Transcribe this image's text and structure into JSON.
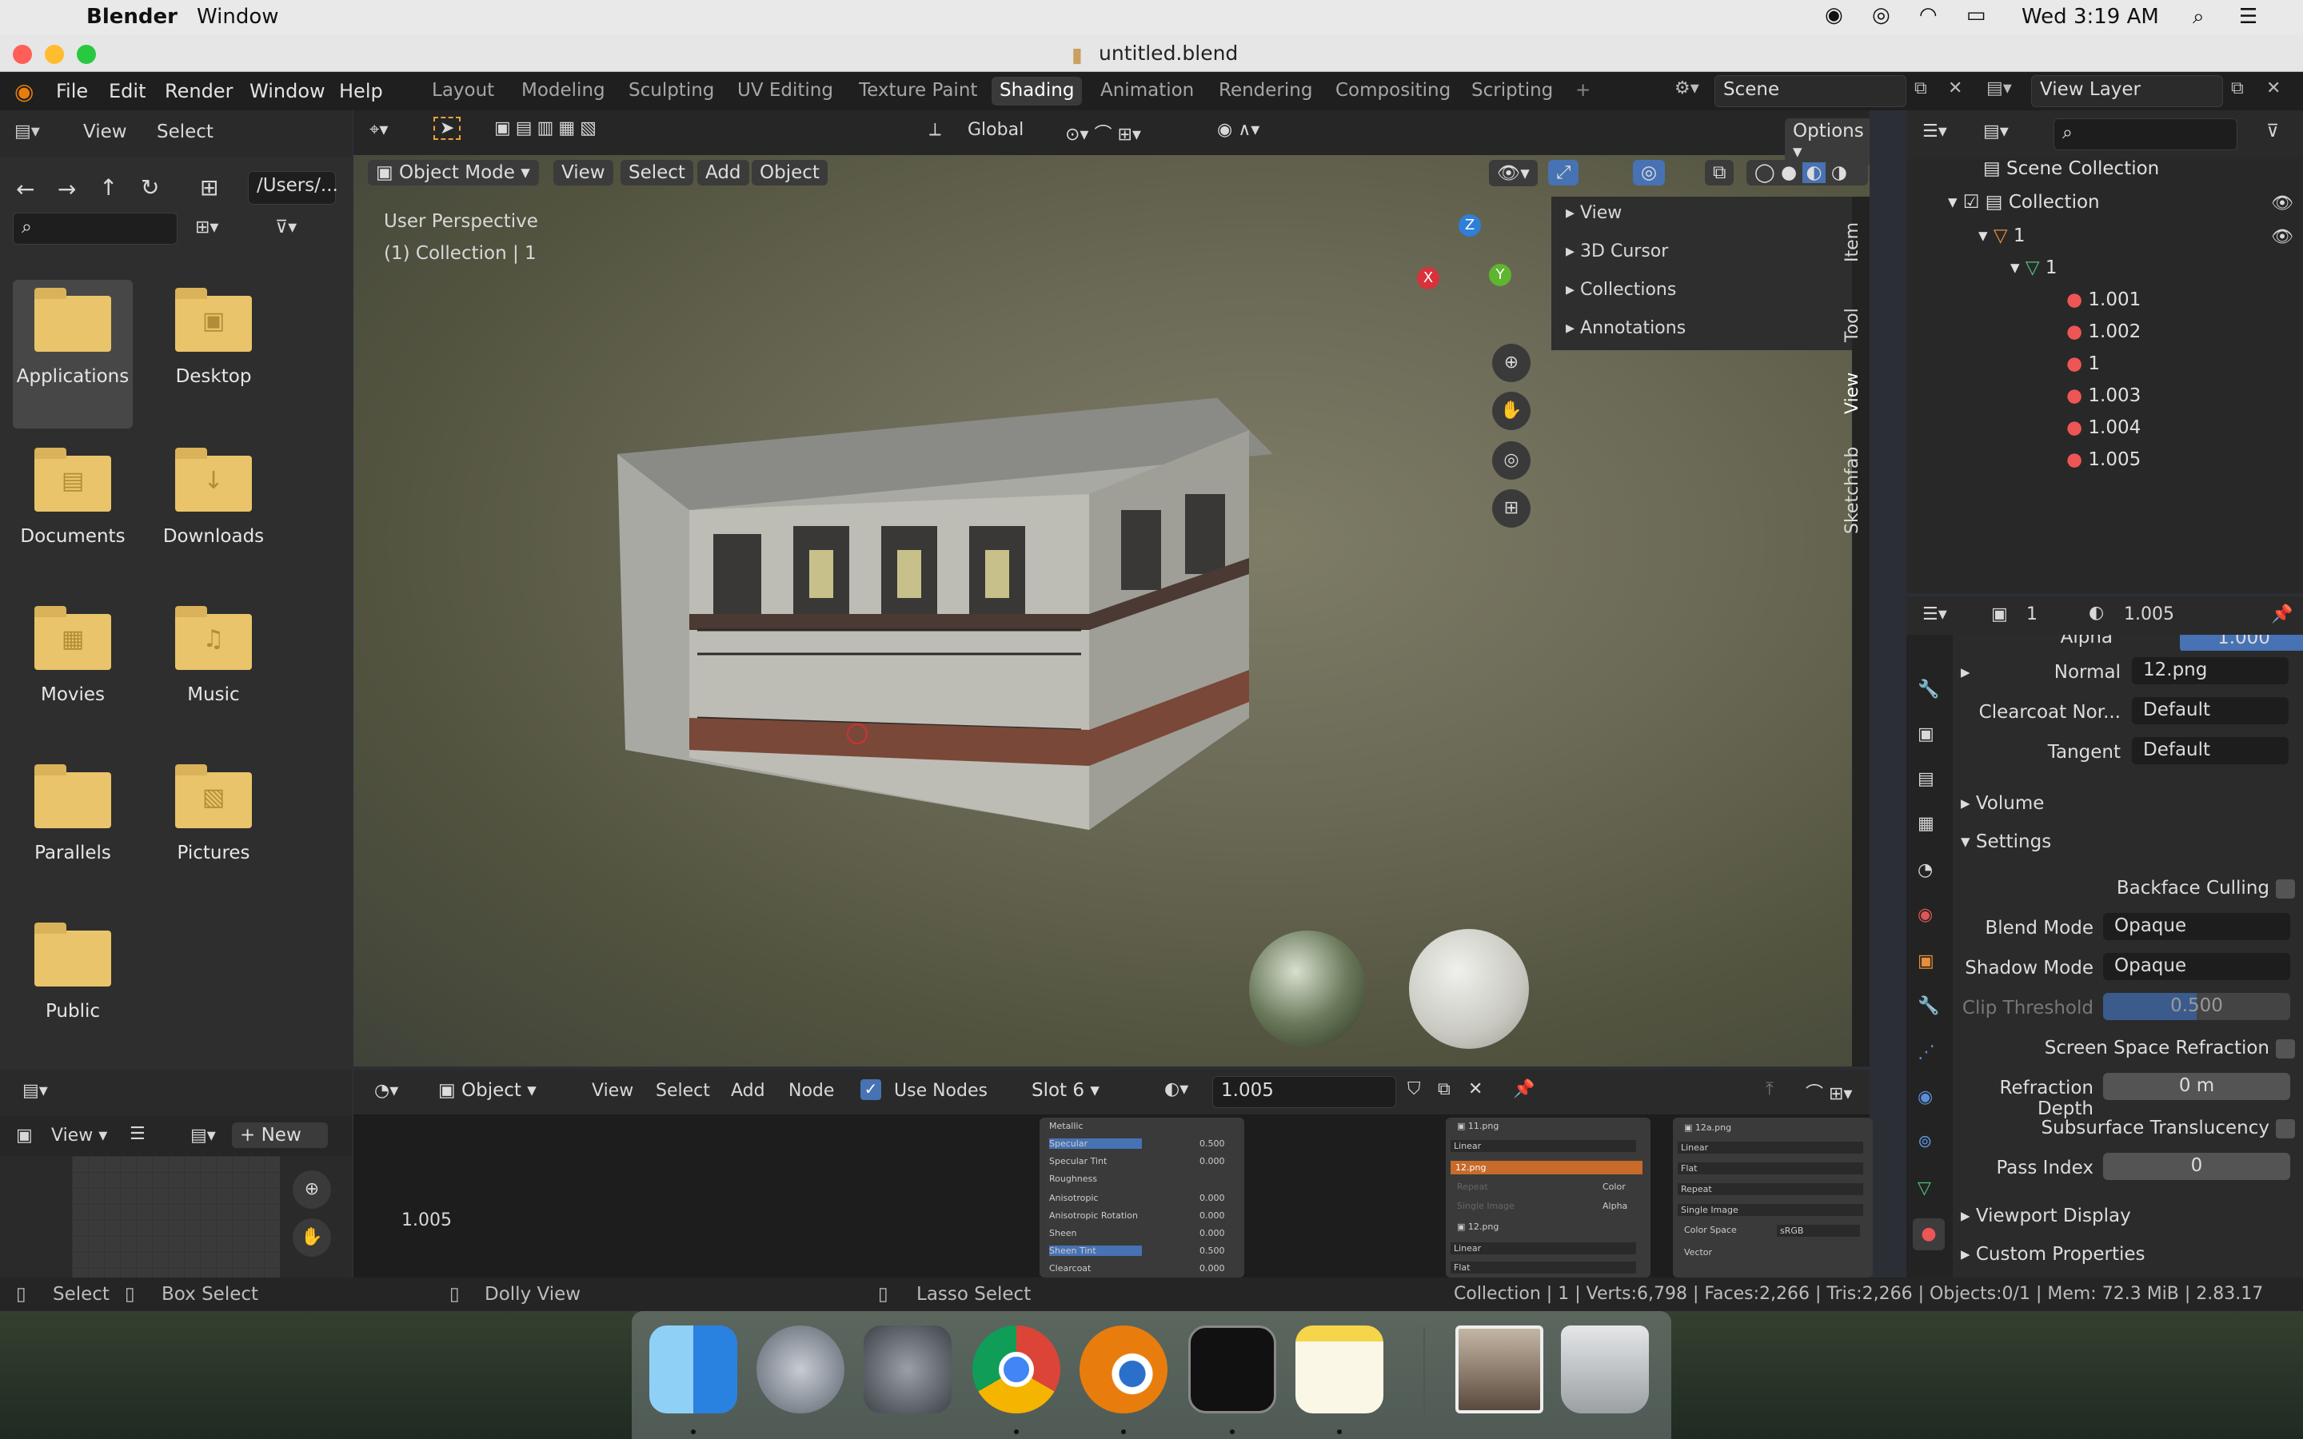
{
  "menubar": {
    "app": "Blender",
    "window": "Window",
    "datetime": "Wed 3:19 AM"
  },
  "title": "untitled.blend",
  "topbar": {
    "menus": [
      "File",
      "Edit",
      "Render",
      "Window",
      "Help"
    ],
    "workspaces": [
      "Layout",
      "Modeling",
      "Sculpting",
      "UV Editing",
      "Texture Paint",
      "Shading",
      "Animation",
      "Rendering",
      "Compositing",
      "Scripting"
    ],
    "active_workspace": "Shading",
    "scene": "Scene",
    "view_layer": "View Layer"
  },
  "filebrowser": {
    "menus": [
      "View",
      "Select"
    ],
    "path": "/Users/...",
    "items": [
      "Applications",
      "Desktop",
      "Documents",
      "Downloads",
      "Movies",
      "Music",
      "Parallels",
      "Pictures",
      "Public"
    ]
  },
  "viewport": {
    "mode": "Object Mode",
    "menus": [
      "View",
      "Select",
      "Add",
      "Object"
    ],
    "orientation": "Global",
    "options": "Options",
    "perspective": "User Perspective",
    "collection_info": "(1) Collection | 1",
    "npanel": [
      "View",
      "3D Cursor",
      "Collections",
      "Annotations"
    ],
    "tabs": [
      "Item",
      "Tool",
      "View",
      "Sketchfab"
    ],
    "active_tab": "View",
    "gizmo": {
      "z": "Z",
      "y": "Y",
      "x": "X"
    }
  },
  "outliner": {
    "root": "Scene Collection",
    "collection": "Collection",
    "object": "1",
    "mesh": "1",
    "materials": [
      "1.001",
      "1.002",
      "1",
      "1.003",
      "1.004",
      "1.005"
    ]
  },
  "properties": {
    "object": "1",
    "material": "1.005",
    "alpha_label": "Alpha",
    "alpha_value": "1.000",
    "rows": [
      {
        "label": "Normal",
        "value": "12.png"
      },
      {
        "label": "Clearcoat Nor...",
        "value": "Default"
      },
      {
        "label": "Tangent",
        "value": "Default"
      }
    ],
    "sections": {
      "volume": "Volume",
      "settings": "Settings",
      "viewport_display": "Viewport Display",
      "custom_properties": "Custom Properties"
    },
    "backface_culling": "Backface Culling",
    "blend_mode": {
      "label": "Blend Mode",
      "value": "Opaque"
    },
    "shadow_mode": {
      "label": "Shadow Mode",
      "value": "Opaque"
    },
    "clip_threshold": {
      "label": "Clip Threshold",
      "value": "0.500"
    },
    "ssr": "Screen Space Refraction",
    "refraction_depth": {
      "label": "Refraction Depth",
      "value": "0 m"
    },
    "sss": "Subsurface Translucency",
    "pass_index": {
      "label": "Pass Index",
      "value": "0"
    }
  },
  "nodeeditor": {
    "type": "Object",
    "menus": [
      "View",
      "Select",
      "Add",
      "Node"
    ],
    "use_nodes": "Use Nodes",
    "slot": "Slot 6",
    "material": "1.005",
    "label": "1.005",
    "bsdf_rows": [
      {
        "name": "Metallic",
        "value": ""
      },
      {
        "name": "Specular",
        "value": "0.500"
      },
      {
        "name": "Specular Tint",
        "value": "0.000"
      },
      {
        "name": "Roughness",
        "value": ""
      },
      {
        "name": "Anisotropic",
        "value": "0.000"
      },
      {
        "name": "Anisotropic Rotation",
        "value": "0.000"
      },
      {
        "name": "Sheen",
        "value": "0.000"
      },
      {
        "name": "Sheen Tint",
        "value": "0.500"
      },
      {
        "name": "Clearcoat",
        "value": "0.000"
      }
    ],
    "img1": {
      "file": "11.png",
      "interp": "Linear",
      "header": "12.png",
      "repeat": "Repeat",
      "single": "Single Image",
      "color": "Color",
      "alpha": "Alpha",
      "file2": "12.png",
      "interp2": "Linear",
      "proj2": "Flat"
    },
    "img2": {
      "file": "12a.png",
      "interp": "Linear",
      "proj": "Flat",
      "ext": "Repeat",
      "src": "Single Image",
      "cs_label": "Color Space",
      "cs": "sRGB",
      "vector": "Vector"
    }
  },
  "imageeditor": {
    "view": "View",
    "new": "New"
  },
  "status": {
    "select": "Select",
    "box_select": "Box Select",
    "dolly": "Dolly View",
    "lasso": "Lasso Select",
    "stats": "Collection | 1 | Verts:6,798 | Faces:2,266 | Tris:2,266 | Objects:0/1 | Mem: 72.3 MiB | 2.83.17"
  },
  "colors": {
    "accent": "#4772b3",
    "folder": "#e9c46a",
    "header_orange": "#c76a2a"
  }
}
